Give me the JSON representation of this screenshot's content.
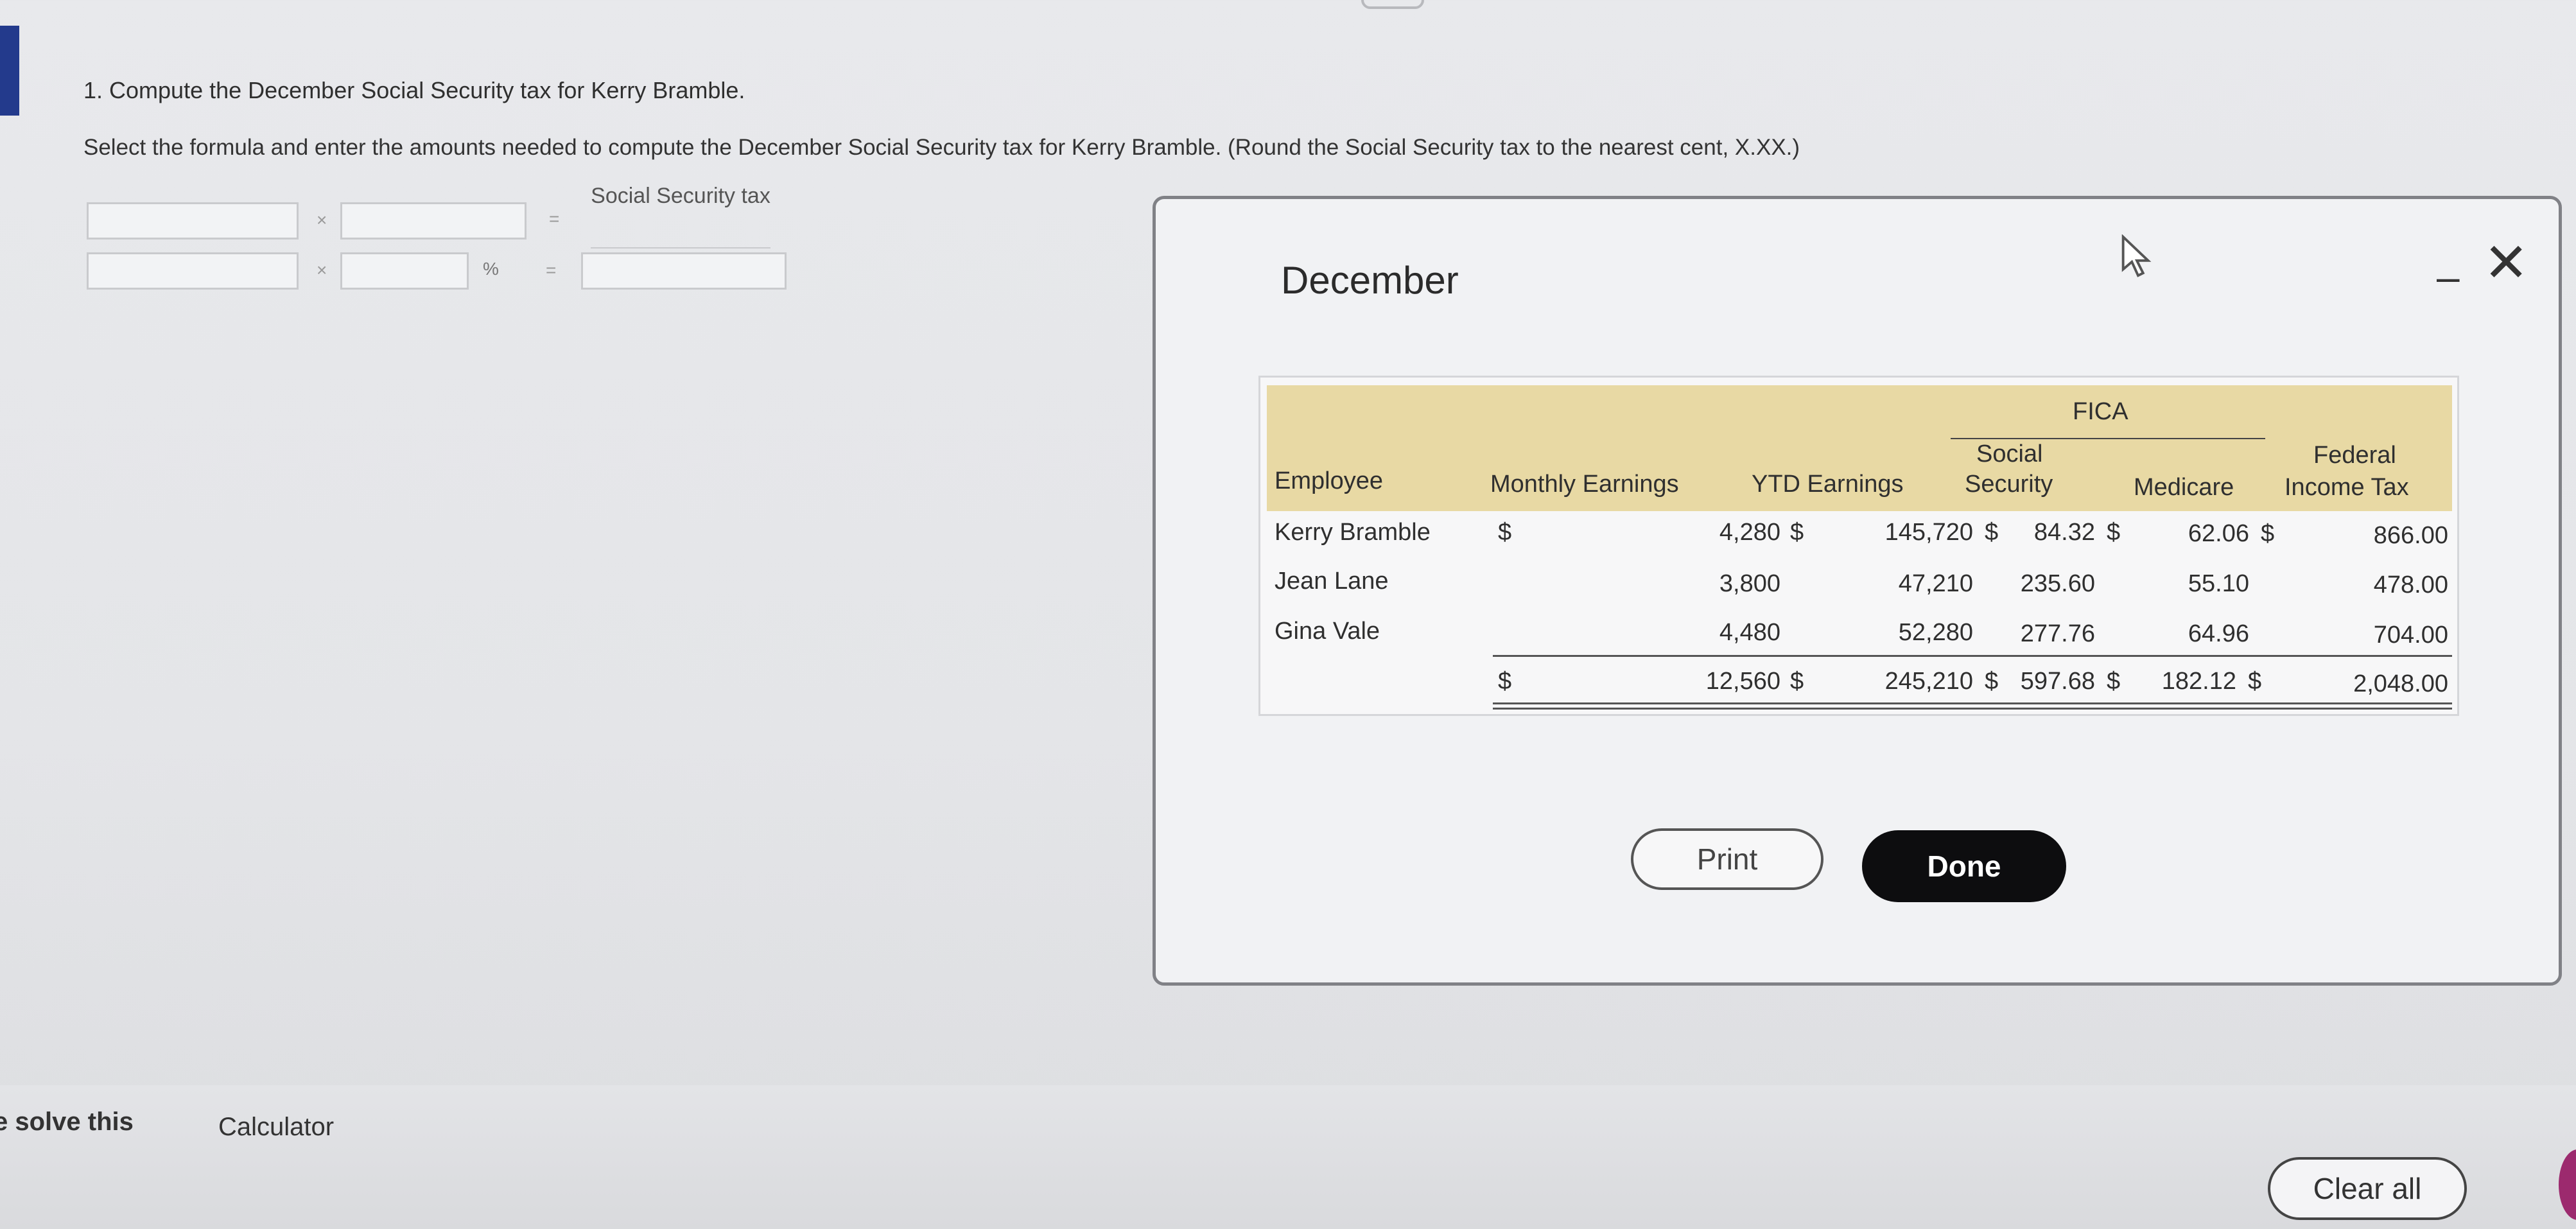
{
  "question": {
    "title": "1. Compute the December Social Security tax for Kerry Bramble.",
    "instructions": "Select the formula and enter the amounts needed to compute the December Social Security tax for Kerry Bramble. (Round the Social Security tax to the nearest cent, X.XX.)"
  },
  "formula": {
    "result_label": "Social Security tax",
    "times_symbol": "×",
    "equals_symbol": "=",
    "percent_symbol": "%"
  },
  "modal": {
    "title": "December",
    "minimize_glyph": "–",
    "close_glyph": "✕",
    "table": {
      "group_header": "FICA",
      "headers": {
        "employee": "Employee",
        "monthly": "Monthly Earnings",
        "ytd": "YTD Earnings",
        "ss_line1": "Social",
        "ss_line2": "Security",
        "medicare": "Medicare",
        "fed_line1": "Federal",
        "fed_line2": "Income Tax"
      },
      "rows": [
        {
          "employee": "Kerry Bramble",
          "monthly_prefix": "$",
          "monthly": "4,280",
          "ytd_prefix": "$",
          "ytd": "145,720",
          "ss_prefix": "$",
          "ss": "84.32",
          "med_prefix": "$",
          "medicare": "62.06",
          "fed_prefix": "$",
          "fed": "866.00"
        },
        {
          "employee": "Jean Lane",
          "monthly_prefix": "",
          "monthly": "3,800",
          "ytd_prefix": "",
          "ytd": "47,210",
          "ss_prefix": "",
          "ss": "235.60",
          "med_prefix": "",
          "medicare": "55.10",
          "fed_prefix": "",
          "fed": "478.00"
        },
        {
          "employee": "Gina Vale",
          "monthly_prefix": "",
          "monthly": "4,480",
          "ytd_prefix": "",
          "ytd": "52,280",
          "ss_prefix": "",
          "ss": "277.76",
          "med_prefix": "",
          "medicare": "64.96",
          "fed_prefix": "",
          "fed": "704.00"
        }
      ],
      "totals": {
        "monthly_prefix": "$",
        "monthly": "12,560",
        "ytd_prefix": "$",
        "ytd": "245,210",
        "ss_prefix": "$",
        "ss": "597.68",
        "med_prefix": "$",
        "medicare": "182.12",
        "fed_prefix": "$",
        "fed": "2,048.00"
      }
    },
    "print_label": "Print",
    "done_label": "Done"
  },
  "footer": {
    "solve_text": "e solve this",
    "calculator_label": "Calculator",
    "clear_all_label": "Clear all"
  },
  "colors": {
    "table_header_bg": "#e8d9a4",
    "done_button_bg": "#0d0d0f",
    "left_accent": "#233a8c"
  }
}
